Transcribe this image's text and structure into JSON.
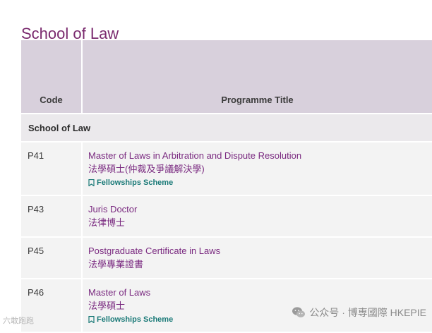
{
  "page": {
    "title": "School of Law"
  },
  "table": {
    "headers": {
      "code": "Code",
      "title": "Programme Title"
    },
    "group": "School of Law",
    "rows": [
      {
        "code": "P41",
        "en": "Master of Laws in Arbitration and Dispute Resolution",
        "zh": "法學碩士(仲裁及爭議解決學)",
        "badge": "Fellowships Scheme"
      },
      {
        "code": "P43",
        "en": "Juris Doctor",
        "zh": "法律博士",
        "badge": ""
      },
      {
        "code": "P45",
        "en": "Postgraduate Certificate in Laws",
        "zh": "法學專業證書",
        "badge": ""
      },
      {
        "code": "P46",
        "en": "Master of Laws",
        "zh": "法學碩士",
        "badge": "Fellowships Scheme"
      }
    ]
  },
  "watermarks": {
    "left": "六敢跑跑",
    "right": "公众号 · 博専國際 HKEPIE",
    "right_icon": "wechat-icon"
  },
  "colors": {
    "accent": "#7a2a6e",
    "link": "#7a2a80",
    "badge": "#1b7a78",
    "header_bg": "#d8d0dc"
  }
}
